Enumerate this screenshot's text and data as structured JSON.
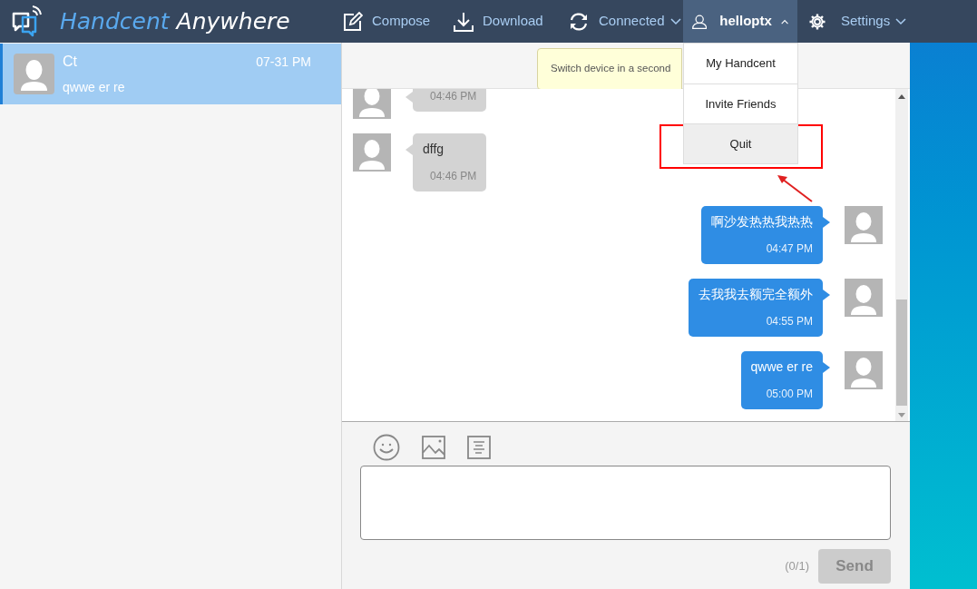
{
  "app": {
    "logo_part1": "Handcent",
    "logo_part2": "Anywhere"
  },
  "nav": [
    {
      "kind": "compose",
      "label": "Compose"
    },
    {
      "kind": "download",
      "label": "Download"
    },
    {
      "kind": "connected",
      "label": "Connected"
    }
  ],
  "user_menu": {
    "username": "helloptx",
    "expanded": true,
    "items": [
      {
        "label": "My Handcent",
        "highlighted": false
      },
      {
        "label": "Invite Friends",
        "highlighted": false
      },
      {
        "label": "Quit",
        "highlighted": true
      }
    ]
  },
  "settings": {
    "label": "Settings"
  },
  "tooltip": {
    "text": "Switch device in a second"
  },
  "conversations": [
    {
      "name": "Ct",
      "time": "07-31 PM",
      "preview": "qwwe er re",
      "selected": true
    }
  ],
  "messages": [
    {
      "kind": "incoming",
      "time": "04:46 PM"
    },
    {
      "kind": "incoming",
      "text": "dffg",
      "time": "04:46 PM"
    },
    {
      "kind": "outgoing",
      "text": "啊沙发热热我热热",
      "time": "04:47 PM"
    },
    {
      "kind": "outgoing",
      "text": "去我我去额完全额外",
      "time": "04:55 PM"
    },
    {
      "kind": "outgoing",
      "text": "qwwe er re",
      "time": "05:00 PM"
    }
  ],
  "composer": {
    "counter": "(0/1)",
    "send": {
      "label": "Send",
      "disabled": true
    }
  }
}
